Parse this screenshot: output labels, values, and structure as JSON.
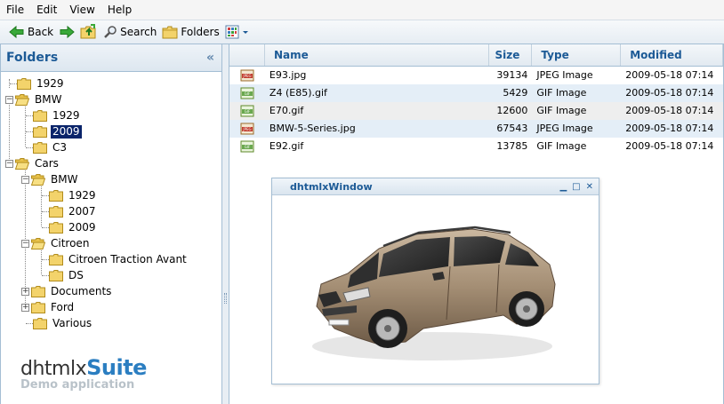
{
  "menu": [
    "File",
    "Edit",
    "View",
    "Help"
  ],
  "toolbar": {
    "back_label": "Back",
    "search_label": "Search",
    "folders_label": "Folders"
  },
  "folders_panel": {
    "title": "Folders",
    "collapse_glyph": "«"
  },
  "tree": {
    "n1929": "1929",
    "bmw": "BMW",
    "bmw_1929": "1929",
    "bmw_2009": "2009",
    "bmw_c3": "C3",
    "cars": "Cars",
    "cars_bmw": "BMW",
    "cars_bmw_1929": "1929",
    "cars_bmw_2007": "2007",
    "cars_bmw_2009": "2009",
    "citroen": "Citroen",
    "citroen_traction": "Citroen Traction Avant",
    "citroen_ds": "DS",
    "documents": "Documents",
    "ford": "Ford",
    "various": "Various",
    "selected": "2009"
  },
  "brand": {
    "main_prefix": "dhtmlx",
    "main_suite": "Suite",
    "sub": "Demo application"
  },
  "grid": {
    "headers": {
      "name": "Name",
      "size": "Size",
      "type": "Type",
      "modified": "Modified"
    },
    "rows": [
      {
        "name": "E93.jpg",
        "size": "39134",
        "type": "JPEG Image",
        "modified": "2009-05-18 07:14",
        "icon": "jpeg-file-icon"
      },
      {
        "name": "Z4 (E85).gif",
        "size": "5429",
        "type": "GIF Image",
        "modified": "2009-05-18 07:14",
        "icon": "gif-file-icon"
      },
      {
        "name": "E70.gif",
        "size": "12600",
        "type": "GIF Image",
        "modified": "2009-05-18 07:14",
        "icon": "gif-file-icon"
      },
      {
        "name": "BMW-5-Series.jpg",
        "size": "67543",
        "type": "JPEG Image",
        "modified": "2009-05-18 07:14",
        "icon": "jpeg-file-icon"
      },
      {
        "name": "E92.gif",
        "size": "13785",
        "type": "GIF Image",
        "modified": "2009-05-18 07:14",
        "icon": "gif-file-icon"
      }
    ]
  },
  "popup": {
    "title": "dhtmlxWindow",
    "image_subject": "suv-car-image"
  },
  "colors": {
    "accent": "#1c5a96",
    "border": "#a4bed4",
    "selection": "#0a246a",
    "row_alt": "#e4eef7"
  }
}
